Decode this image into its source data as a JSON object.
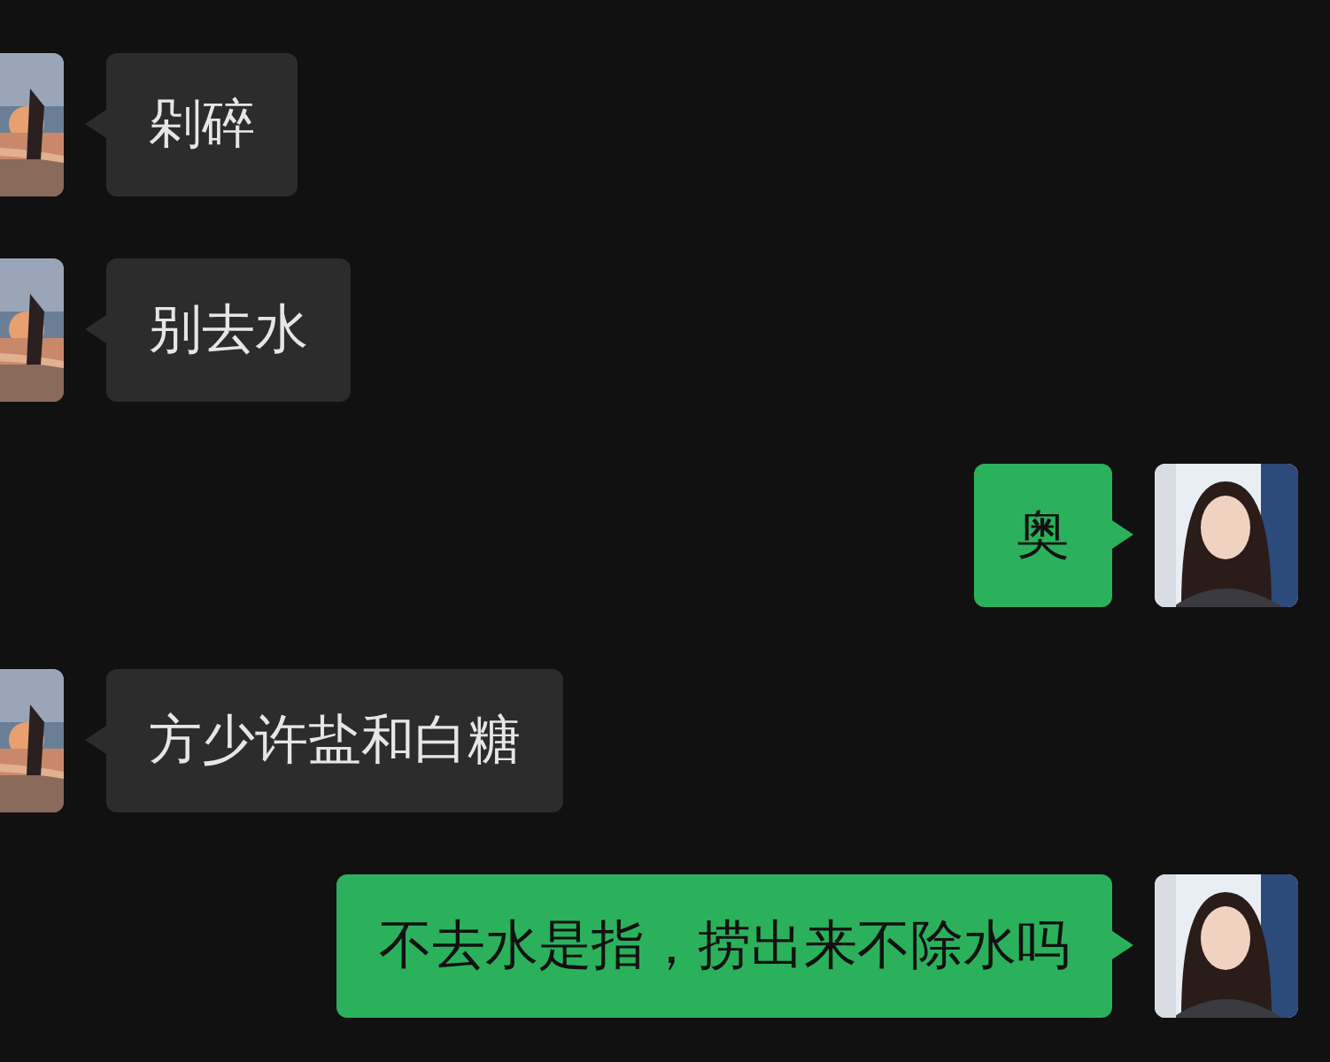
{
  "messages": [
    {
      "kind": "incoming",
      "text": "剁碎"
    },
    {
      "kind": "incoming",
      "text": "别去水"
    },
    {
      "kind": "outgoing",
      "text": "奥"
    },
    {
      "kind": "incoming",
      "text": "方少许盐和白糖"
    },
    {
      "kind": "outgoing",
      "text": "不去水是指，捞出来不除水吗"
    }
  ]
}
